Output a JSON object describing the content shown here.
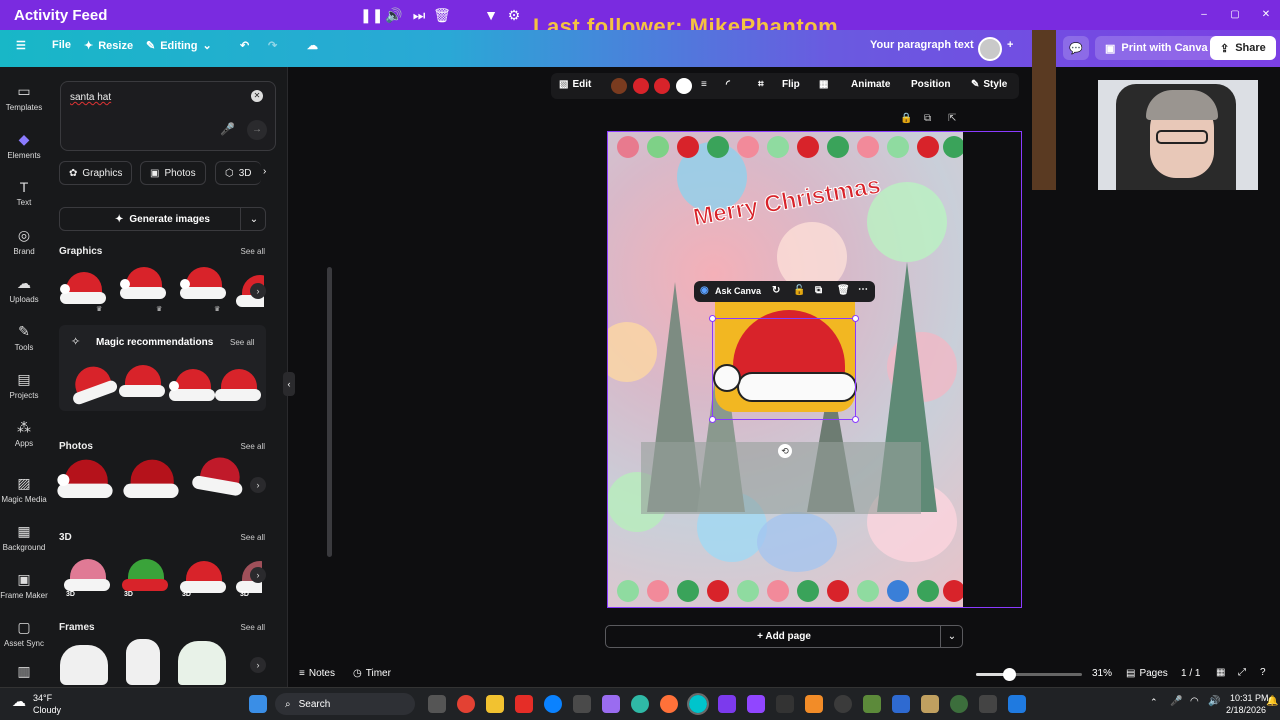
{
  "window": {
    "title": "Activity Feed"
  },
  "overlay": {
    "text": "Last follower: MikePhantom"
  },
  "menubar": {
    "file": "File",
    "resize": "Resize",
    "editing": "Editing",
    "paragraph_text": "Your paragraph text",
    "print": "Print with Canva",
    "share": "Share"
  },
  "sidenav": [
    {
      "label": "Templates",
      "icon": "templates-icon"
    },
    {
      "label": "Elements",
      "icon": "elements-icon"
    },
    {
      "label": "Text",
      "icon": "text-icon"
    },
    {
      "label": "Brand",
      "icon": "brand-icon"
    },
    {
      "label": "Uploads",
      "icon": "uploads-icon"
    },
    {
      "label": "Tools",
      "icon": "tools-icon"
    },
    {
      "label": "Projects",
      "icon": "projects-icon"
    },
    {
      "label": "Apps",
      "icon": "apps-icon"
    },
    {
      "label": "Magic Media",
      "icon": "magic-media-icon"
    },
    {
      "label": "Background",
      "icon": "background-icon"
    },
    {
      "label": "Frame Maker",
      "icon": "frame-maker-icon"
    },
    {
      "label": "Asset Sync",
      "icon": "asset-sync-icon"
    }
  ],
  "search": {
    "value": "santa hat"
  },
  "chips": [
    "Graphics",
    "Photos",
    "3D"
  ],
  "generate": "Generate images",
  "sections": {
    "graphics": "Graphics",
    "magic": "Magic recommendations",
    "photos": "Photos",
    "threed": "3D",
    "frames": "Frames",
    "see_all": "See all",
    "three_d_tag": "3D"
  },
  "editbar": {
    "edit": "Edit",
    "flip": "Flip",
    "animate": "Animate",
    "position": "Position",
    "style": "Style",
    "colors": [
      "#7a3b1f",
      "#d8232a",
      "#d8232a",
      "#ffffff"
    ]
  },
  "design": {
    "greeting": "Merry Christmas"
  },
  "ask": {
    "label": "Ask Canva"
  },
  "addpage": "+ Add page",
  "bottom": {
    "notes": "Notes",
    "timer": "Timer",
    "zoom": "31%",
    "pages": "Pages",
    "page_count": "1 / 1",
    "zoom_level": 0.31
  },
  "taskbar": {
    "weather_temp": "34°F",
    "weather_desc": "Cloudy",
    "search": "Search",
    "time": "10:31 PM",
    "date": "2/18/2026"
  }
}
